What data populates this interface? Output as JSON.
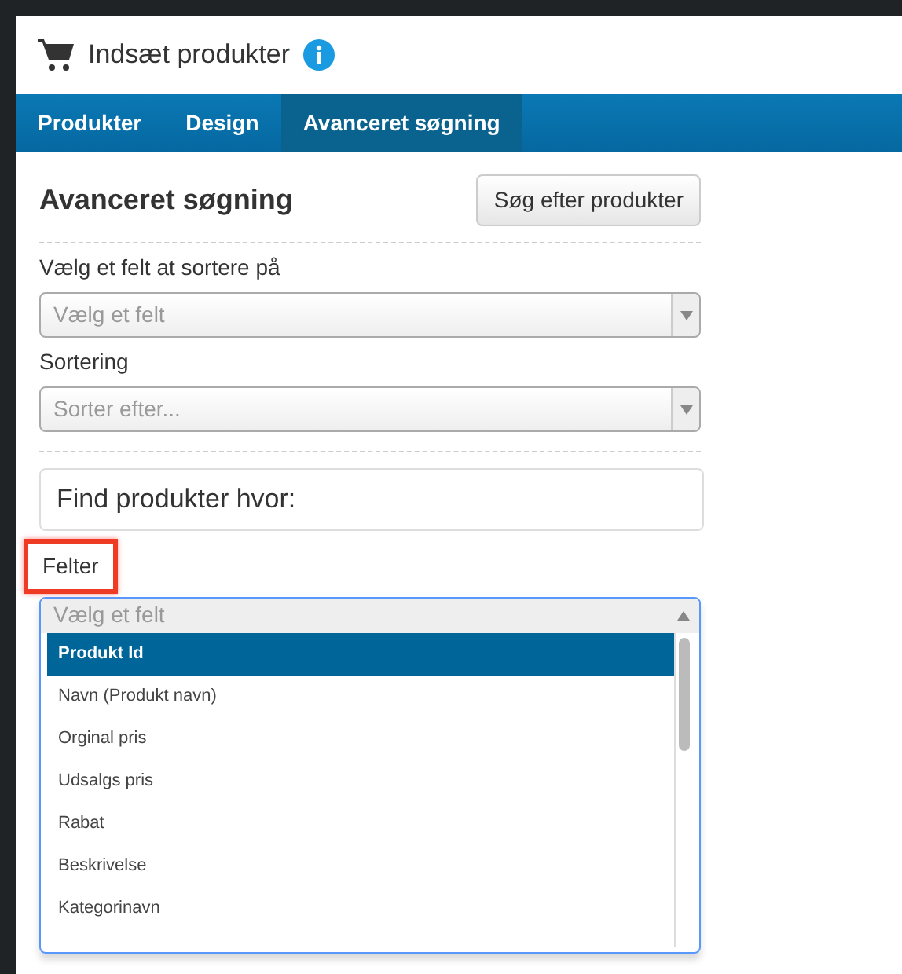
{
  "dialog": {
    "title": "Indsæt produkter"
  },
  "tabs": [
    {
      "label": "Produkter",
      "selected": false
    },
    {
      "label": "Design",
      "selected": false
    },
    {
      "label": "Avanceret søgning",
      "selected": true
    }
  ],
  "heading": "Avanceret søgning",
  "search_button": "Søg efter produkter",
  "sort_field": {
    "label": "Vælg et felt at sortere på",
    "placeholder": "Vælg et felt"
  },
  "sorting": {
    "label": "Sortering",
    "placeholder": "Sorter efter..."
  },
  "filter_panel": {
    "title": "Find produkter hvor:"
  },
  "fields": {
    "label": "Felter",
    "highlighted": true,
    "placeholder": "Vælg et felt",
    "expanded": true,
    "options": [
      {
        "label": "Produkt Id",
        "selected": true
      },
      {
        "label": "Navn (Produkt navn)",
        "selected": false
      },
      {
        "label": "Orginal pris",
        "selected": false
      },
      {
        "label": "Udsalgs pris",
        "selected": false
      },
      {
        "label": "Rabat",
        "selected": false
      },
      {
        "label": "Beskrivelse",
        "selected": false
      },
      {
        "label": "Kategorinavn",
        "selected": false
      }
    ]
  }
}
